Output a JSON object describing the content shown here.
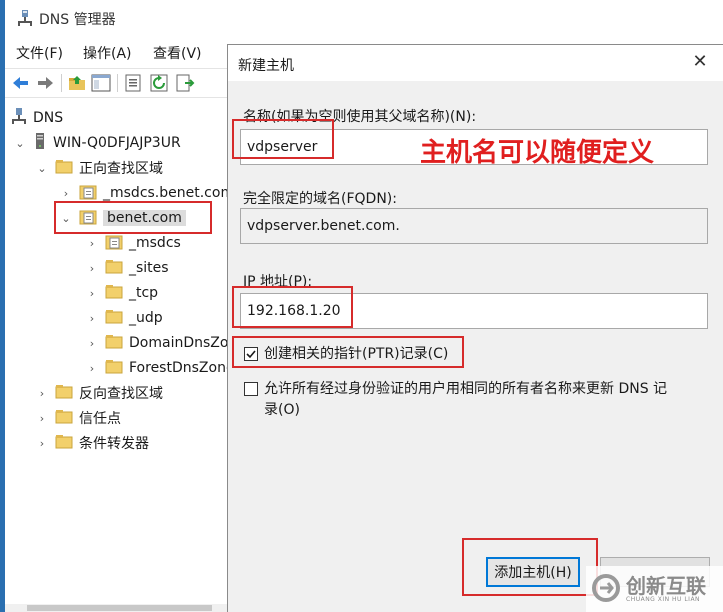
{
  "window": {
    "title": "DNS 管理器"
  },
  "menu": {
    "items": [
      "文件(F)",
      "操作(A)",
      "查看(V)"
    ]
  },
  "toolbar": {
    "buttons": [
      "back-arrow-icon",
      "forward-arrow-icon",
      "up-folder-icon",
      "show-hide-console-tree-icon",
      "properties-icon",
      "refresh-icon",
      "export-list-icon"
    ]
  },
  "tree": {
    "items": [
      {
        "label": "DNS",
        "icon": "dns-icon",
        "chevron": ""
      },
      {
        "label": "WIN-Q0DFJAJP3UR",
        "icon": "server-icon",
        "chevron": "down"
      },
      {
        "label": "正向查找区域",
        "icon": "folder-icon",
        "chevron": "down"
      },
      {
        "label": "_msdcs.benet.com",
        "icon": "zone-file-icon",
        "chevron": "right"
      },
      {
        "label": "benet.com",
        "icon": "zone-file-icon",
        "chevron": "down"
      },
      {
        "label": "_msdcs",
        "icon": "zone-file-icon",
        "chevron": "right"
      },
      {
        "label": "_sites",
        "icon": "folder-icon",
        "chevron": "right"
      },
      {
        "label": "_tcp",
        "icon": "folder-icon",
        "chevron": "right"
      },
      {
        "label": "_udp",
        "icon": "folder-icon",
        "chevron": "right"
      },
      {
        "label": "DomainDnsZones",
        "icon": "folder-icon",
        "chevron": "right"
      },
      {
        "label": "ForestDnsZones",
        "icon": "folder-icon",
        "chevron": "right"
      },
      {
        "label": "反向查找区域",
        "icon": "folder-icon",
        "chevron": "right"
      },
      {
        "label": "信任点",
        "icon": "folder-icon",
        "chevron": "right"
      },
      {
        "label": "条件转发器",
        "icon": "folder-icon",
        "chevron": "right"
      }
    ]
  },
  "dialog": {
    "title": "新建主机",
    "name_label": "名称(如果为空则使用其父域名称)(N):",
    "name_value": "vdpserver",
    "fqdn_label": "完全限定的域名(FQDN):",
    "fqdn_value": "vdpserver.benet.com.",
    "ip_label": "IP 地址(P):",
    "ip_value": "192.168.1.20",
    "ptr_checkbox_label": "创建相关的指针(PTR)记录(C)",
    "ptr_checked": true,
    "allow_update_label_line1": "允许所有经过身份验证的用户用相同的所有者名称来更新 DNS 记",
    "allow_update_label_line2": "录(O)",
    "allow_update_checked": false,
    "add_host_button": "添加主机(H)"
  },
  "annotation": {
    "text": "主机名可以随便定义",
    "color": "#e01f1f"
  },
  "watermark": {
    "text": "创新互联",
    "sub": "CHUANG XIN HU LIAN"
  }
}
